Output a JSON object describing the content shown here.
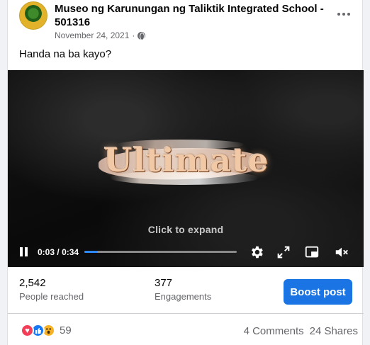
{
  "post": {
    "page_name": "Museo ng Karunungan ng Taliktik Integrated School - 501316",
    "date": "November 24, 2021",
    "date_separator": "·",
    "caption": "Handa na ba kayo?",
    "avatar_text": "Museo ng Karunungan",
    "privacy_icon": "globe-icon",
    "more_icon": "more-options-icon"
  },
  "video": {
    "title_text": "Ultimate",
    "expand_hint": "Click to expand",
    "current_time": "0:03",
    "time_separator": "/",
    "duration": "0:34",
    "progress": 0.088,
    "icons": {
      "pause": "pause-icon",
      "settings": "gear-icon",
      "fullscreen": "expand-icon",
      "pip": "picture-in-picture-icon",
      "mute": "muted-speaker-icon"
    }
  },
  "insights": {
    "reach_value": "2,542",
    "reach_label": "People reached",
    "engagement_value": "377",
    "engagement_label": "Engagements",
    "boost_label": "Boost post"
  },
  "footer": {
    "reaction_count": "59",
    "comments": "4 Comments",
    "shares": "24 Shares",
    "reactions": [
      "love",
      "like",
      "wow"
    ]
  },
  "colors": {
    "accent": "#1b74e4",
    "progress": "#2d88ff",
    "love": "#f33e58",
    "like": "#1877f2",
    "wow": "#f7b125"
  }
}
